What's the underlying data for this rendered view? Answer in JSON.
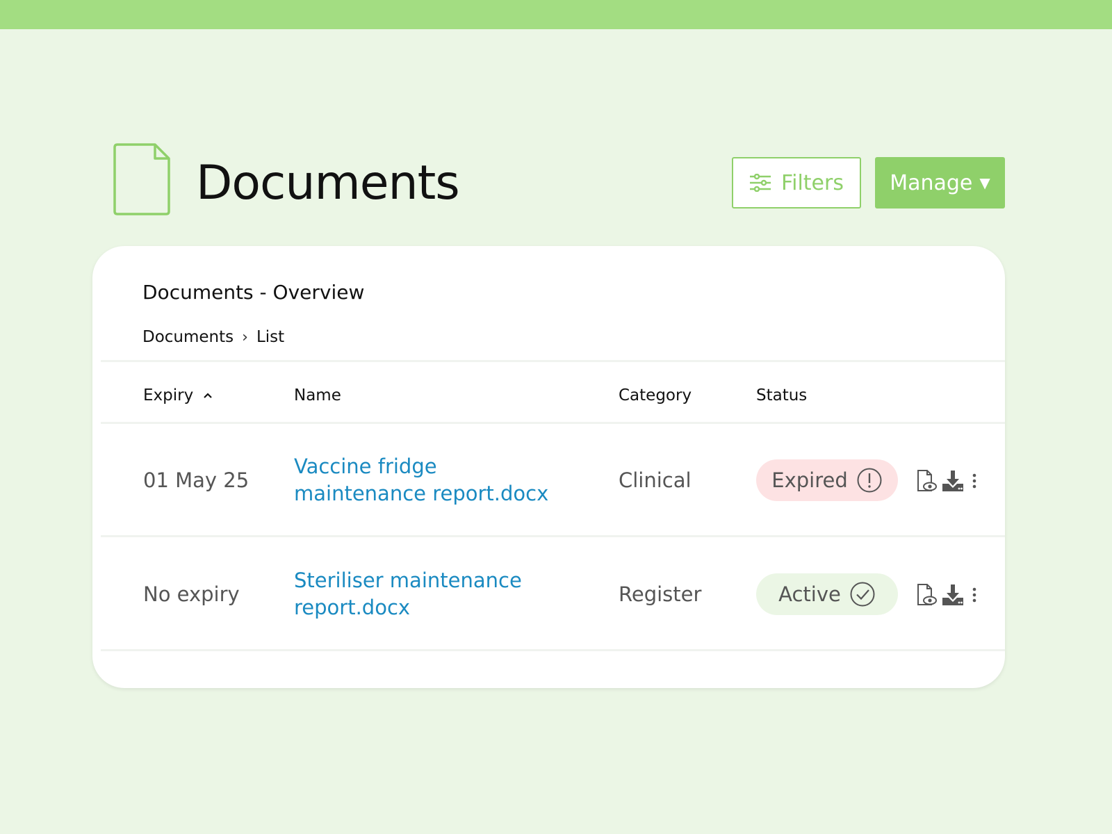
{
  "header": {
    "title": "Documents",
    "filters_label": "Filters",
    "manage_label": "Manage",
    "accent_color": "#8fd06a",
    "top_bar_color": "#a3dd82"
  },
  "card": {
    "title": "Documents - Overview",
    "breadcrumb": [
      "Documents",
      "List"
    ],
    "columns": {
      "expiry": "Expiry",
      "name": "Name",
      "category": "Category",
      "status": "Status"
    },
    "sort": {
      "column": "expiry",
      "direction": "ascending"
    },
    "rows": [
      {
        "expiry": "01 May 25",
        "name_line1": "Vaccine fridge",
        "name_line2": "maintenance report.docx",
        "category": "Clinical",
        "status": "Expired",
        "status_icon": "exclamation-circle-icon",
        "status_color": "#fde2e3"
      },
      {
        "expiry": "No expiry",
        "name_line1": "Steriliser maintenance",
        "name_line2": "report.docx",
        "category": "Register",
        "status": "Active",
        "status_icon": "check-circle-icon",
        "status_color": "#ebf6e5"
      }
    ]
  }
}
